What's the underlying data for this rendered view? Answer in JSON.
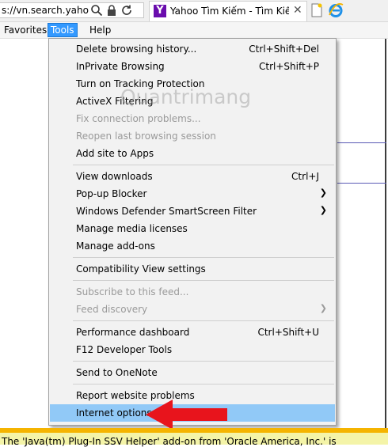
{
  "address": {
    "url_fragment": "s://vn.search.yaho..."
  },
  "tab": {
    "favicon_letter": "Y",
    "title": "Yahoo Tìm Kiếm - Tìm Kiế..."
  },
  "menubar": {
    "favorites": "Favorites",
    "tools": "Tools",
    "help": "Help"
  },
  "tools_menu": {
    "items": [
      {
        "label": "Delete browsing history...",
        "shortcut": "Ctrl+Shift+Del"
      },
      {
        "label": "InPrivate Browsing",
        "shortcut": "Ctrl+Shift+P"
      },
      {
        "label": "Turn on Tracking Protection",
        "shortcut": ""
      },
      {
        "label": "ActiveX Filtering",
        "shortcut": ""
      },
      {
        "label": "Fix connection problems...",
        "shortcut": "",
        "disabled": true
      },
      {
        "label": "Reopen last browsing session",
        "shortcut": "",
        "disabled": true
      },
      {
        "label": "Add site to Apps",
        "shortcut": ""
      },
      {
        "label": "View downloads",
        "shortcut": "Ctrl+J"
      },
      {
        "label": "Pop-up Blocker",
        "shortcut": "",
        "submenu": true
      },
      {
        "label": "Windows Defender SmartScreen Filter",
        "shortcut": "",
        "submenu": true
      },
      {
        "label": "Manage media licenses",
        "shortcut": ""
      },
      {
        "label": "Manage add-ons",
        "shortcut": ""
      },
      {
        "label": "Compatibility View settings",
        "shortcut": ""
      },
      {
        "label": "Subscribe to this feed...",
        "shortcut": "",
        "disabled": true
      },
      {
        "label": "Feed discovery",
        "shortcut": "",
        "disabled": true,
        "submenu": true
      },
      {
        "label": "Performance dashboard",
        "shortcut": "Ctrl+Shift+U"
      },
      {
        "label": "F12 Developer Tools",
        "shortcut": ""
      },
      {
        "label": "Send to OneNote",
        "shortcut": ""
      },
      {
        "label": "Report website problems",
        "shortcut": ""
      },
      {
        "label": "Internet options",
        "shortcut": "",
        "highlighted": true
      }
    ]
  },
  "watermark": "Quantrimang",
  "notification": {
    "text": "The 'Java(tm) Plug-In SSV Helper' add-on from 'Oracle America, Inc.' is"
  },
  "colors": {
    "menu_highlight": "#91c9f7",
    "tools_active": "#3399ff",
    "arrow": "#e8141c",
    "notify_border": "#f5b400"
  }
}
